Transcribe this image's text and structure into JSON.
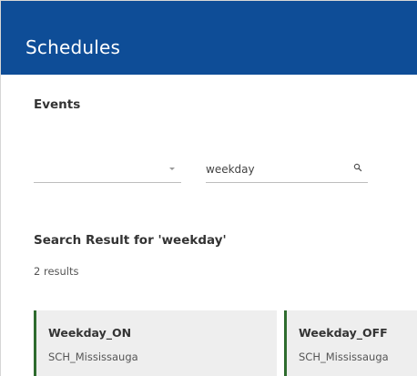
{
  "header": {
    "title": "Schedules"
  },
  "events": {
    "title": "Events",
    "filter_select": {
      "selected": ""
    },
    "search": {
      "value": "weekday",
      "placeholder": "",
      "icon": "search-icon"
    }
  },
  "results": {
    "title": "Search Result for 'weekday'",
    "count_label": "2 results",
    "items": [
      {
        "name": "Weekday_ON",
        "location": "SCH_Mississauga"
      },
      {
        "name": "Weekday_OFF",
        "location": "SCH_Mississauga"
      }
    ]
  },
  "colors": {
    "header_bg": "#0e4d97",
    "card_accent": "#2e6b2e",
    "card_bg": "#eeeeee"
  }
}
